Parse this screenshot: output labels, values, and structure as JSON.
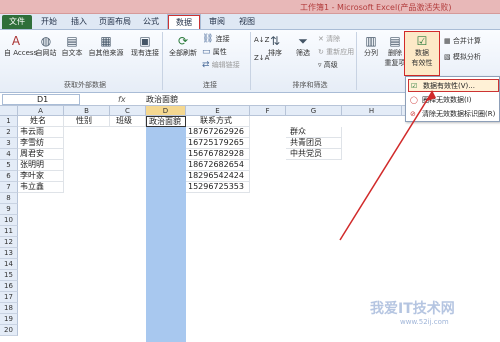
{
  "titlebar": {
    "title": "工作簿1 - Microsoft Excel(产品激活失败)"
  },
  "tabs": [
    "文件",
    "开始",
    "插入",
    "页面布局",
    "公式",
    "数据",
    "审阅",
    "视图"
  ],
  "ribbon": {
    "get_external": {
      "items": [
        "自 Access",
        "自网站",
        "自文本",
        "自其他来源",
        "现有连接"
      ],
      "group_label": "获取外部数据"
    },
    "connections": {
      "refresh_all": "全部刷新",
      "small": [
        "连接",
        "属性",
        "编辑链接"
      ],
      "group_label": "连接"
    },
    "sort_filter": {
      "sort_small": [
        "A↓Z",
        "Z↓A"
      ],
      "sort": "排序",
      "filter": "筛选",
      "filter_small": [
        "清除",
        "重新应用",
        "高级"
      ],
      "group_label": "排序和筛选"
    },
    "data_tools": {
      "text_to_columns": "分列",
      "remove_dup": "删除",
      "remove_dup2": "重复项",
      "validation": "数据",
      "validation2": "有效性",
      "consolidate": "合并计算",
      "what_if": "模拟分析"
    }
  },
  "formula_bar": {
    "namebox": "D1",
    "fx": "fx",
    "content": "政治面貌"
  },
  "columns": [
    "A",
    "B",
    "C",
    "D",
    "E",
    "F",
    "G",
    "H"
  ],
  "rows": [
    "1",
    "2",
    "3",
    "4",
    "5",
    "6",
    "7",
    "8",
    "9",
    "10",
    "11",
    "12",
    "13",
    "14",
    "15",
    "16",
    "17",
    "18",
    "19",
    "20"
  ],
  "header_row": [
    "姓名",
    "性别",
    "班级",
    "政治面貌",
    "联系方式"
  ],
  "records": [
    {
      "name": "韦云雨",
      "phone": "18767262926"
    },
    {
      "name": "李雪纺",
      "phone": "16725179265"
    },
    {
      "name": "周君安",
      "phone": "15676782928"
    },
    {
      "name": "张明明",
      "phone": "18672682654"
    },
    {
      "name": "李叶家",
      "phone": "18296542424"
    },
    {
      "name": "韦立鑫",
      "phone": "15296725353"
    }
  ],
  "g_column": [
    "群众",
    "共青团员",
    "中共党员"
  ],
  "menu": {
    "items": [
      "数据有效性(V)...",
      "圈释无效数据(I)",
      "清除无效数据标识圈(R)"
    ]
  },
  "watermark": {
    "line1": "我爱IT技术网",
    "line2": "www.52ij.com"
  }
}
